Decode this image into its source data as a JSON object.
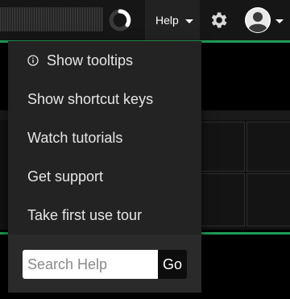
{
  "navbar": {
    "help_label": "Help",
    "icons": {
      "spinner": "loading-spinner-icon",
      "caret": "caret-down-icon",
      "settings": "gear-icon",
      "user": "user-avatar-icon"
    }
  },
  "help_menu": {
    "items": [
      {
        "label": "Show tooltips",
        "icon": "info-icon"
      },
      {
        "label": "Show shortcut keys"
      },
      {
        "label": "Watch tutorials"
      },
      {
        "label": "Get support"
      },
      {
        "label": "Take first use tour"
      }
    ],
    "search": {
      "value": "",
      "placeholder": "Search Help",
      "go_label": "Go"
    }
  },
  "colors": {
    "navbar_bg": "#161616",
    "menu_bg": "#232323",
    "accent_green": "#1f9d55",
    "text": "#e6e6e6"
  }
}
